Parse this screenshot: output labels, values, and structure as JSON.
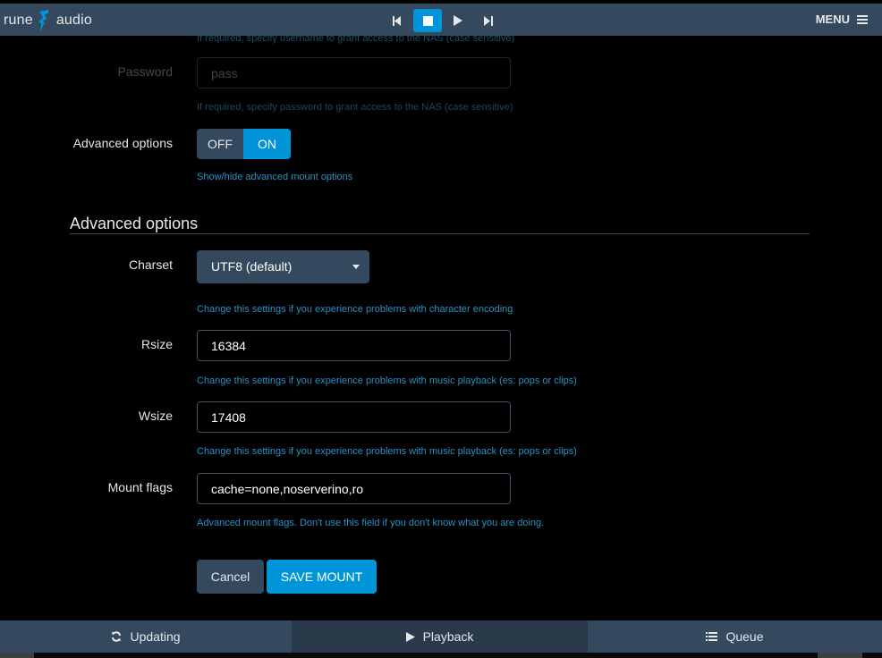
{
  "topbar": {
    "logo_left": "rune",
    "logo_right": "audio",
    "menu_label": "MENU",
    "transport": [
      "previous-icon",
      "stop-icon",
      "play-icon",
      "next-icon"
    ],
    "active_transport": "stop-icon"
  },
  "form": {
    "username_help": "If required, specify username to grant access to the NAS (case sensitive)",
    "password_label": "Password",
    "password_placeholder": "pass",
    "password_help": "If required, specify password to grant access to the NAS (case sensitive)",
    "advanced_label": "Advanced options",
    "toggle_off": "OFF",
    "toggle_on": "ON",
    "toggle_state": "ON",
    "advanced_help": "Show/hide advanced mount options"
  },
  "advanced": {
    "section_title": "Advanced options",
    "charset_label": "Charset",
    "charset_value": "UTF8 (default)",
    "charset_help": "Change this settings if you experience problems with character encoding",
    "rsize_label": "Rsize",
    "rsize_value": "16384",
    "rsize_help": "Change this settings if you experience problems with music playback (es: pops or clips)",
    "wsize_label": "Wsize",
    "wsize_value": "17408",
    "wsize_help": "Change this settings if you experience problems with music playback (es: pops or clips)",
    "flags_label": "Mount flags",
    "flags_value": "cache=none,noserverino,ro",
    "flags_help": "Advanced mount flags. Don't use this field if you don't know what you are doing."
  },
  "buttons": {
    "cancel": "Cancel",
    "save": "SAVE MOUNT"
  },
  "bottombar": {
    "tabs": [
      {
        "label": "Updating",
        "icon": "refresh-icon"
      },
      {
        "label": "Playback",
        "icon": "play-icon"
      },
      {
        "label": "Queue",
        "icon": "list-icon"
      }
    ],
    "active_tab": "Playback"
  },
  "colors": {
    "bar": "#34495e",
    "accent": "#0095d8",
    "help_text": "#2d8fc4",
    "background": "#000000"
  }
}
